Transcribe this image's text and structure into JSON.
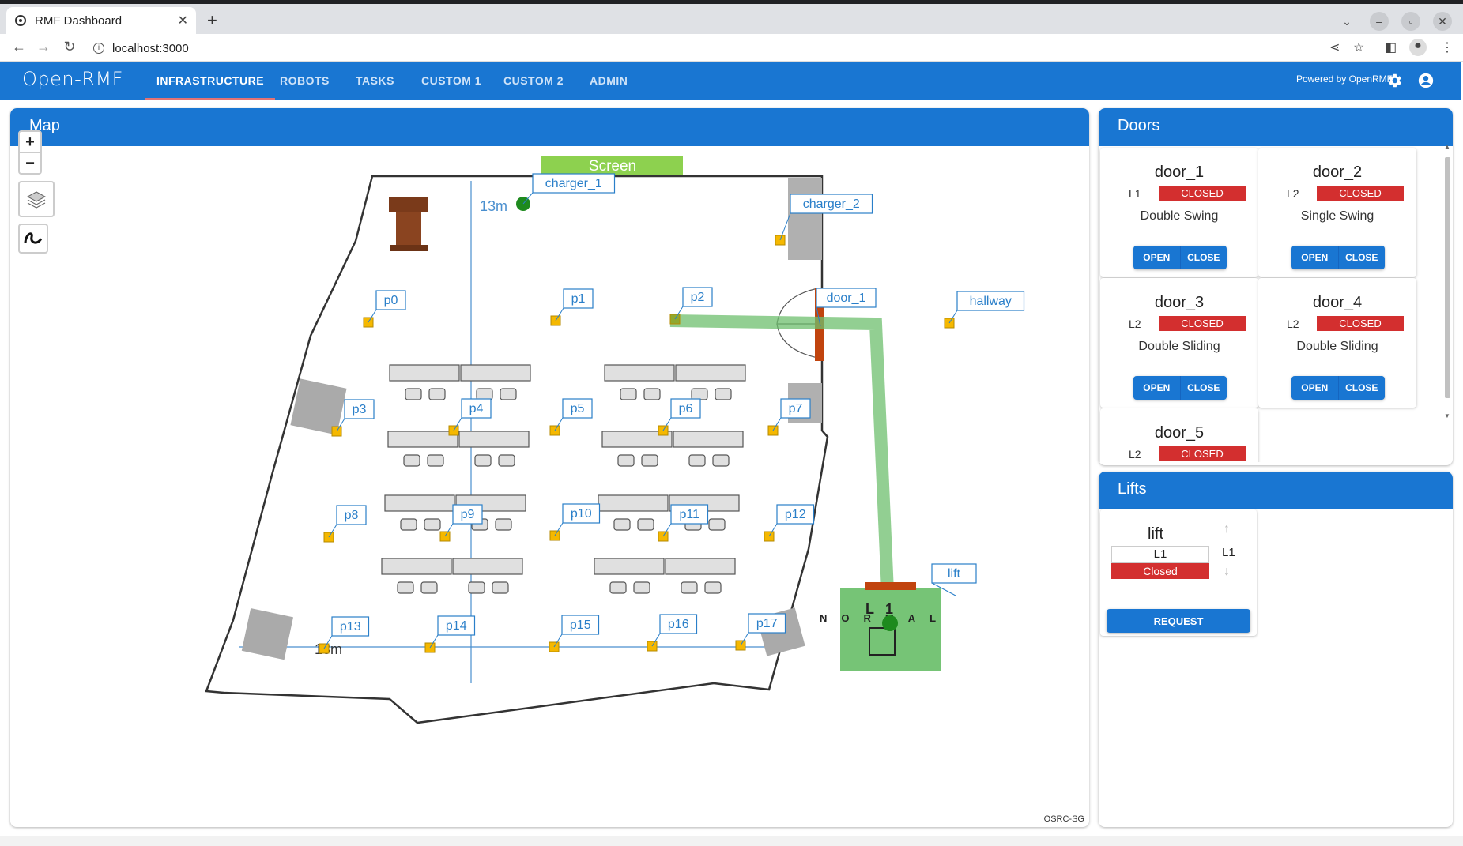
{
  "browser": {
    "tab_title": "RMF Dashboard",
    "url": "localhost:3000"
  },
  "appbar": {
    "logo_text": "Open-RMF",
    "tabs": [
      {
        "label": "INFRASTRUCTURE",
        "active": true
      },
      {
        "label": "ROBOTS",
        "active": false
      },
      {
        "label": "TASKS",
        "active": false
      },
      {
        "label": "CUSTOM 1",
        "active": false
      },
      {
        "label": "CUSTOM 2",
        "active": false
      },
      {
        "label": "ADMIN",
        "active": false
      }
    ],
    "powered_by": "Powered by OpenRMF"
  },
  "map": {
    "title": "Map",
    "zoom_in": "+",
    "zoom_out": "−",
    "attribution": "OSRC-SG",
    "screen_label": "Screen",
    "dimension_vertical": "13m",
    "dimension_horizontal": "13m",
    "waypoints": [
      "p0",
      "p1",
      "p2",
      "p3",
      "p4",
      "p5",
      "p6",
      "p7",
      "p8",
      "p9",
      "p10",
      "p11",
      "p12",
      "p13",
      "p14",
      "p15",
      "p16",
      "p17",
      "hallway",
      "lift",
      "door_1"
    ],
    "chargers": [
      "charger_1",
      "charger_2"
    ],
    "lift_mode_text": "NORMAL",
    "lift_floor_text": "L1",
    "colors": {
      "path": "#6dbf6d",
      "door": "#c1440e",
      "waypoint": "#f5b800",
      "label_border": "#2a7fc9",
      "lift_box": "#76c476"
    }
  },
  "doors": {
    "title": "Doors",
    "open_label": "OPEN",
    "close_label": "CLOSE",
    "items": [
      {
        "name": "door_1",
        "level": "L1",
        "state": "CLOSED",
        "type": "Double Swing"
      },
      {
        "name": "door_2",
        "level": "L2",
        "state": "CLOSED",
        "type": "Single Swing"
      },
      {
        "name": "door_3",
        "level": "L2",
        "state": "CLOSED",
        "type": "Double Sliding"
      },
      {
        "name": "door_4",
        "level": "L2",
        "state": "CLOSED",
        "type": "Double Sliding"
      },
      {
        "name": "door_5",
        "level": "L2",
        "state": "CLOSED",
        "type": ""
      }
    ]
  },
  "lifts": {
    "title": "Lifts",
    "items": [
      {
        "name": "lift",
        "floor": "L1",
        "state": "Closed",
        "current_floor": "L1",
        "request_label": "REQUEST"
      }
    ]
  }
}
